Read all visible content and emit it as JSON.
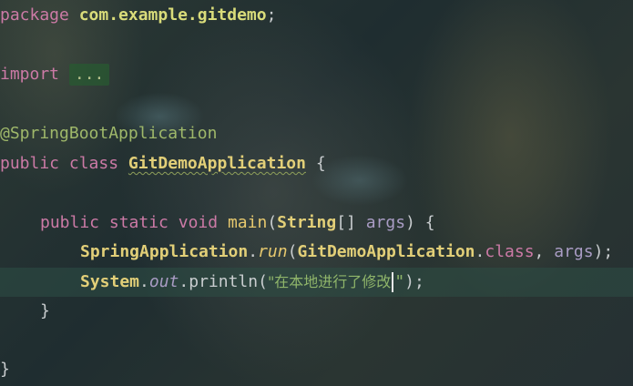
{
  "editor": {
    "line_package": {
      "keyword": "package",
      "name": "com.example.gitdemo",
      "semicolon": ";"
    },
    "line_import": {
      "keyword": "import",
      "folded": "..."
    },
    "line_annotation": "@SpringBootApplication",
    "line_class": {
      "kw_public": "public",
      "kw_class": "class",
      "name": "GitDemoApplication",
      "brace": " {"
    },
    "line_main": {
      "kw_public": "public",
      "kw_static": "static",
      "kw_void": "void",
      "method": "main",
      "open": "(",
      "type": "String",
      "arr": "[] ",
      "param": "args",
      "close": ") {"
    },
    "line_run": {
      "cls": "SpringApplication",
      "dot1": ".",
      "method": "run",
      "open": "(",
      "arg_cls": "GitDemoApplication",
      "dot2": ".",
      "kw_class": "class",
      "comma": ", ",
      "param": "args",
      "close": ");"
    },
    "line_print": {
      "cls": "System",
      "dot1": ".",
      "field": "out",
      "dot2": ".",
      "method": "println",
      "open": "(",
      "string_before_caret": "\"在本地进行了修改",
      "string_after_caret": "\"",
      "close": ");"
    },
    "line_close_method": "}",
    "line_close_class": "}"
  }
}
